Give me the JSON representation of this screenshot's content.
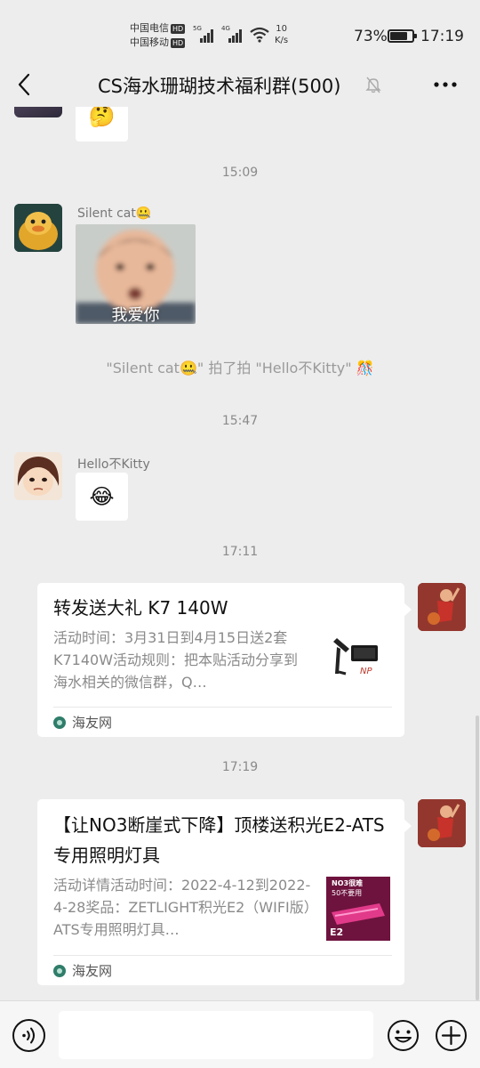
{
  "status_bar": {
    "carrier1": "中国电信",
    "carrier2": "中国移动",
    "hd": "HD",
    "sig1_tag": "5G",
    "sig2_tag": "4G",
    "net_speed_value": "10",
    "net_speed_unit": "K/s",
    "battery_percent": "73%",
    "battery_level": 0.73,
    "time": "17:19"
  },
  "header": {
    "title": "CS海水珊瑚技术福利群(500)",
    "muted": true
  },
  "messages": {
    "top_emoji": "🤔",
    "ts1": "15:09",
    "msg1_sender": "Silent cat🤐",
    "msg1_sticker_caption": "我爱你",
    "system_pat": "\"Silent cat🤐\" 拍了拍 \"Hello不Kitty\" 🎊",
    "ts2": "15:47",
    "msg2_sender": "Hello不Kitty",
    "msg2_emoji": "😂",
    "ts3": "17:11",
    "card1": {
      "title": "转发送大礼 K7 140W",
      "desc": "活动时间：3月31日到4月15日送2套K7140W活动规则：把本贴活动分享到海水相关的微信群，Q…",
      "source": "海友网",
      "thumb_brand": "NP"
    },
    "ts4": "17:19",
    "card2": {
      "title": "【让NO3断崖式下降】顶楼送积光E2-ATS专用照明灯具",
      "desc": "活动详情活动时间：2022-4-12到2022-4-28奖品：ZETLIGHT积光E2（WIFI版）ATS专用照明灯具…",
      "source": "海友网",
      "thumb_line1": "NO3很难",
      "thumb_line2": "50不要用",
      "thumb_brand": "E2"
    }
  },
  "input_bar": {
    "placeholder": ""
  },
  "colors": {
    "background": "#ededed",
    "bubble": "#ffffff",
    "timestamp": "#8a8a8a"
  }
}
